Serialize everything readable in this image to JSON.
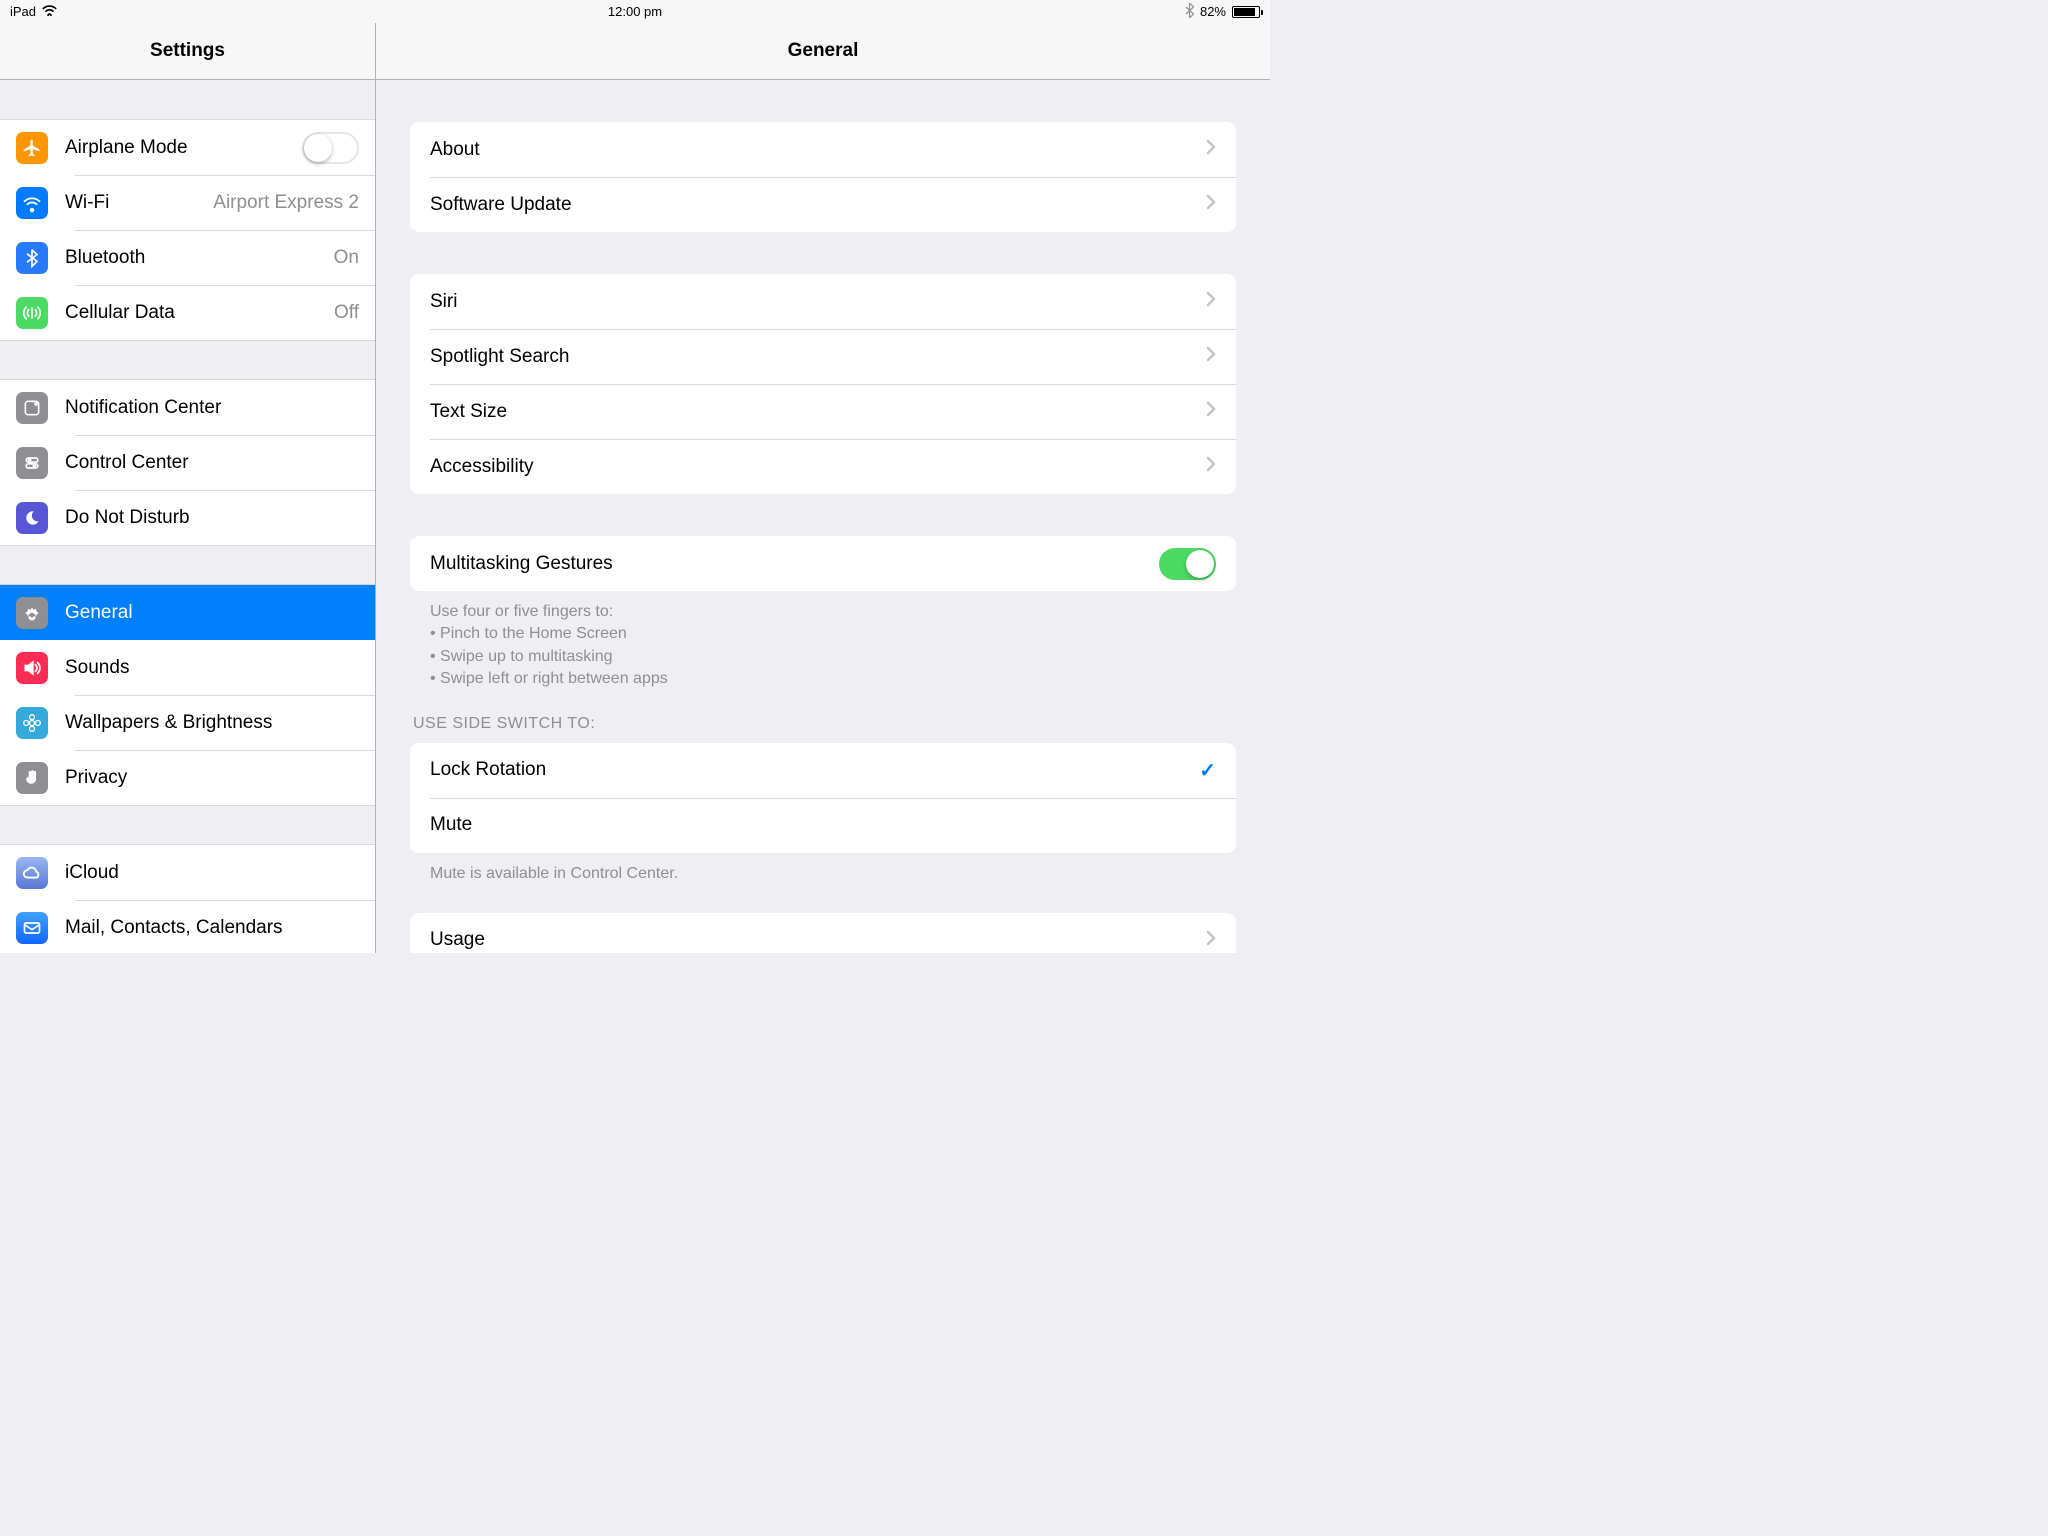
{
  "statusbar": {
    "device": "iPad",
    "time": "12:00 pm",
    "battery": "82%"
  },
  "sidebar": {
    "title": "Settings",
    "g1": {
      "airplane": "Airplane Mode",
      "wifi": "Wi-Fi",
      "wifi_val": "Airport Express 2",
      "bluetooth": "Bluetooth",
      "bluetooth_val": "On",
      "cellular": "Cellular Data",
      "cellular_val": "Off"
    },
    "g2": {
      "notif": "Notification Center",
      "cc": "Control Center",
      "dnd": "Do Not Disturb"
    },
    "g3": {
      "general": "General",
      "sounds": "Sounds",
      "wallpapers": "Wallpapers & Brightness",
      "privacy": "Privacy"
    },
    "g4": {
      "icloud": "iCloud",
      "mail": "Mail, Contacts, Calendars"
    }
  },
  "main": {
    "title": "General",
    "g1": {
      "about": "About",
      "software": "Software Update"
    },
    "g2": {
      "siri": "Siri",
      "spotlight": "Spotlight Search",
      "textsize": "Text Size",
      "accessibility": "Accessibility"
    },
    "g3": {
      "multi": "Multitasking Gestures"
    },
    "g3_note_l1": "Use four or five fingers to:",
    "g3_note_l2": "• Pinch to the Home Screen",
    "g3_note_l3": "• Swipe up to multitasking",
    "g3_note_l4": "• Swipe left or right between apps",
    "g4_header": "Use Side Switch To:",
    "g4": {
      "lock": "Lock Rotation",
      "mute": "Mute"
    },
    "g4_note": "Mute is available in Control Center.",
    "g5": {
      "usage": "Usage"
    }
  },
  "colors": {
    "airplane": "#ff9500",
    "wifi": "#007aff",
    "bluetooth": "#287aff",
    "cellular": "#4cd964",
    "notif": "#8e8e93",
    "cc": "#8e8e93",
    "dnd": "#5856d6",
    "general": "#8e8e93",
    "sounds": "#ff2d55",
    "wallpapers": "#34aadc",
    "privacy": "#8e8e93",
    "icloud": "#748fe1",
    "mail": "#1c73fd"
  }
}
